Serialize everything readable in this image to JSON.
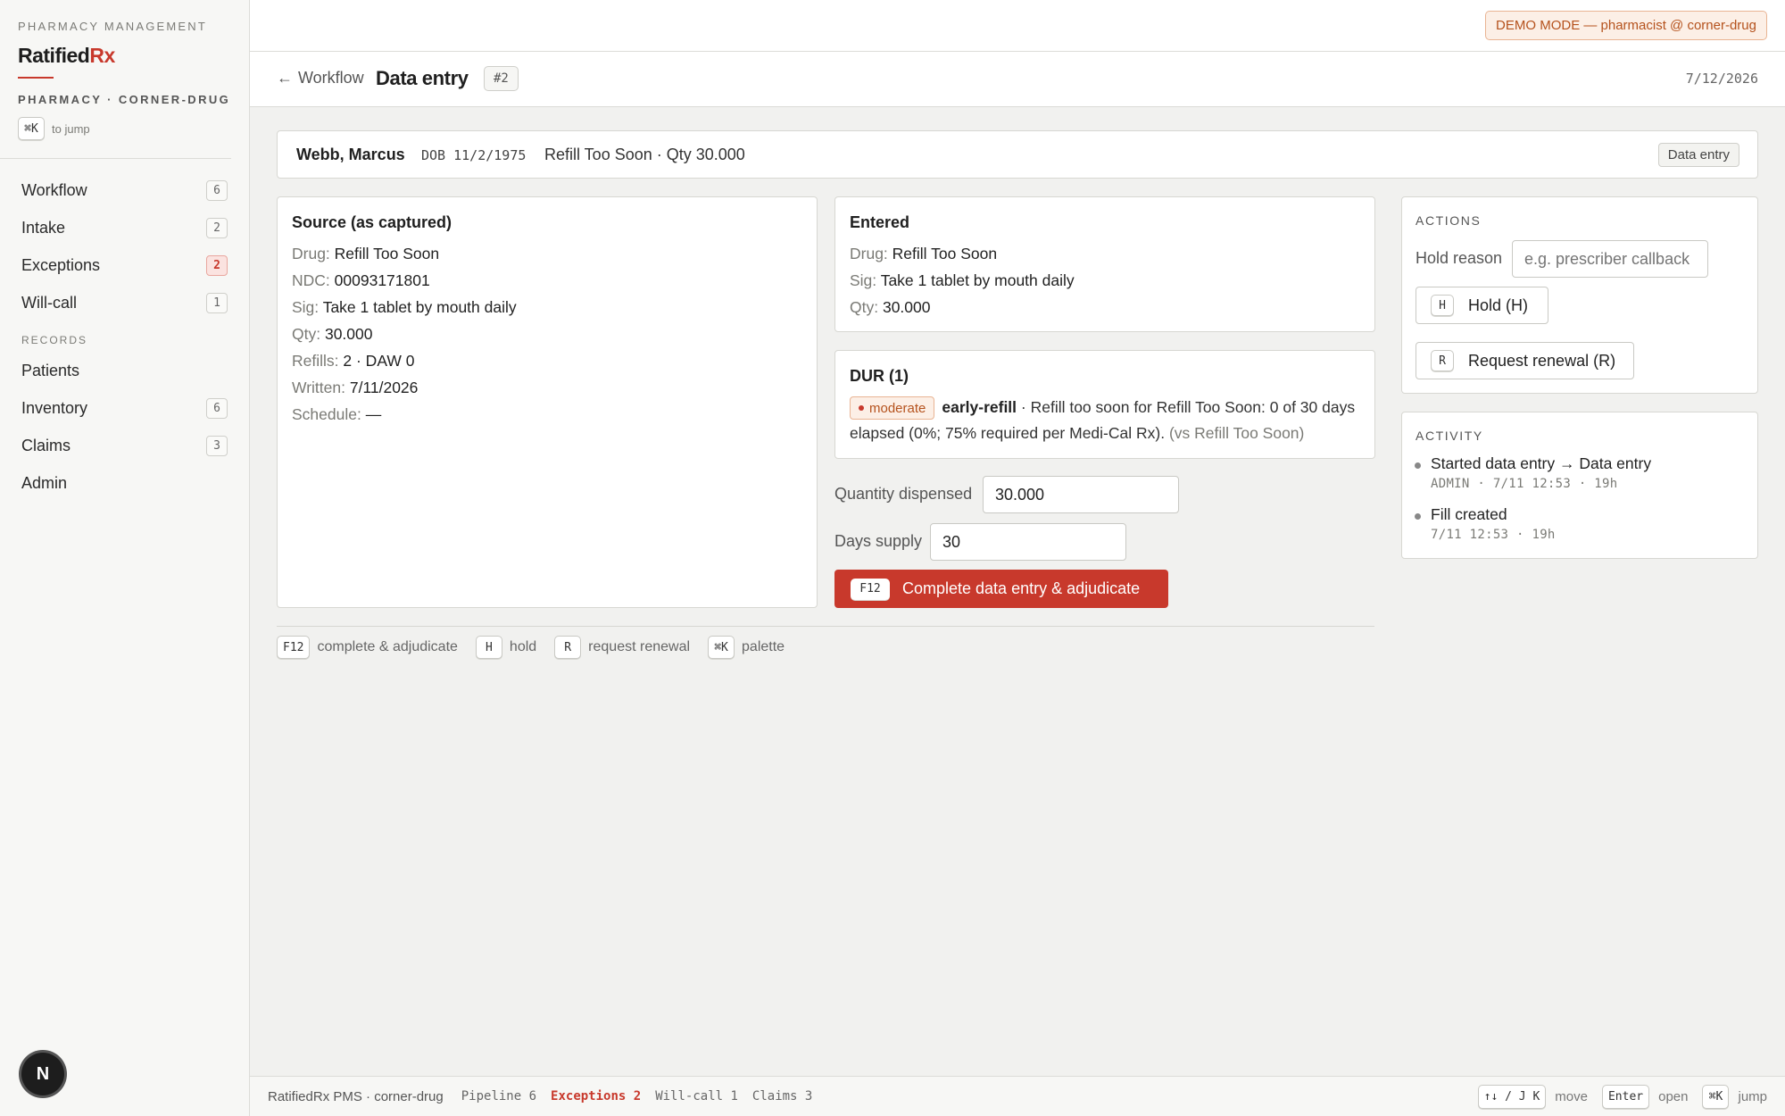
{
  "sidebar": {
    "kicker": "PHARMACY MANAGEMENT",
    "logo_main": "Ratified",
    "logo_accent": "Rx",
    "pharmacy": "PHARMACY · CORNER-DRUG",
    "jump_key": "⌘K",
    "jump_label": "to jump",
    "nav": [
      {
        "label": "Workflow",
        "count": "6"
      },
      {
        "label": "Intake",
        "count": "2"
      },
      {
        "label": "Exceptions",
        "count": "2"
      },
      {
        "label": "Will-call",
        "count": "1"
      }
    ],
    "records_label": "RECORDS",
    "records": [
      {
        "label": "Patients",
        "count": ""
      },
      {
        "label": "Inventory",
        "count": "6"
      },
      {
        "label": "Claims",
        "count": "3"
      },
      {
        "label": "Admin",
        "count": ""
      }
    ],
    "badge": "N"
  },
  "topbar": {
    "demo": "DEMO MODE — pharmacist @ corner-drug"
  },
  "header": {
    "back_label": "Workflow",
    "title": "Data entry",
    "fill_tag": "#2",
    "date": "7/12/2026"
  },
  "patient": {
    "name": "Webb, Marcus",
    "dob": "DOB 11/2/1975",
    "drug_qty": "Refill Too Soon · Qty 30.000",
    "stage": "Data entry"
  },
  "source": {
    "title": "Source (as captured)",
    "rows": [
      {
        "k": "Drug:",
        "v": "Refill Too Soon"
      },
      {
        "k": "NDC:",
        "v": "00093171801"
      },
      {
        "k": "Sig:",
        "v": "Take 1 tablet by mouth daily"
      },
      {
        "k": "Qty:",
        "v": "30.000"
      },
      {
        "k": "Refills:",
        "v": "2 · DAW 0"
      },
      {
        "k": "Written:",
        "v": "7/11/2026"
      },
      {
        "k": "Schedule:",
        "v": "—"
      }
    ]
  },
  "entered": {
    "title": "Entered",
    "rows": [
      {
        "k": "Drug:",
        "v": "Refill Too Soon"
      },
      {
        "k": "Sig:",
        "v": "Take 1 tablet by mouth daily"
      },
      {
        "k": "Qty:",
        "v": "30.000"
      }
    ]
  },
  "dur": {
    "title": "DUR (1)",
    "severity": "moderate",
    "code": "early-refill",
    "message": " · Refill too soon for Refill Too Soon: 0 of 30 days elapsed (0%; 75% required per Medi-Cal Rx).",
    "vs": "(vs Refill Too Soon)"
  },
  "form": {
    "qty_label": "Quantity dispensed",
    "qty_value": "30.000",
    "days_label": "Days supply",
    "days_value": "30",
    "submit_key": "F12",
    "submit_label": "Complete data entry & adjudicate"
  },
  "hints": [
    {
      "key": "F12",
      "label": "complete & adjudicate"
    },
    {
      "key": "H",
      "label": "hold"
    },
    {
      "key": "R",
      "label": "request renewal"
    },
    {
      "key": "⌘K",
      "label": "palette"
    }
  ],
  "actions": {
    "title": "ACTIONS",
    "hold_reason_label": "Hold reason",
    "hold_reason_placeholder": "e.g. prescriber callback",
    "hold_key": "H",
    "hold_label": "Hold (H)",
    "renew_key": "R",
    "renew_label": "Request renewal (R)"
  },
  "activity": {
    "title": "ACTIVITY",
    "items": [
      {
        "text": "Started data entry → Data entry",
        "sub": "ADMIN · 7/11 12:53 · 19h"
      },
      {
        "text": "Fill created",
        "sub": "7/11 12:53 · 19h"
      }
    ]
  },
  "footer": {
    "left": "RatifiedRx PMS · corner-drug",
    "pipeline": "Pipeline 6",
    "exceptions": "Exceptions 2",
    "willcall": "Will-call 1",
    "claims": "Claims 3",
    "move_key": "↑↓ / J K",
    "move_label": "move",
    "open_key": "Enter",
    "open_label": "open",
    "jump_key": "⌘K",
    "jump_label": "jump"
  },
  "colors": {
    "accent": "#c8392c",
    "demo_bg": "#fcefe6",
    "demo_text": "#b5521d"
  }
}
